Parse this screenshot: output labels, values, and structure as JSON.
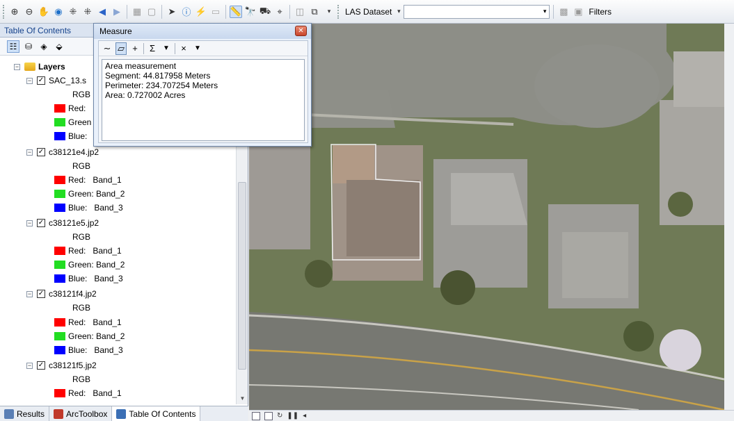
{
  "toolbar": {
    "las_label": "LAS Dataset",
    "filters_label": "Filters"
  },
  "toc": {
    "title": "Table Of Contents",
    "root": "Layers",
    "layers": [
      {
        "name": "SAC_13.s",
        "rgb": "RGB",
        "bands": [
          {
            "label": "Red:",
            "color": "#ff0000"
          },
          {
            "label": "Green",
            "color": "#22dd22"
          },
          {
            "label": "Blue:",
            "color": "#0000ff"
          }
        ]
      },
      {
        "name": "c38121e4.jp2",
        "rgb": "RGB",
        "bands": [
          {
            "label": "Red:   Band_1",
            "color": "#ff0000"
          },
          {
            "label": "Green: Band_2",
            "color": "#22dd22"
          },
          {
            "label": "Blue:   Band_3",
            "color": "#0000ff"
          }
        ]
      },
      {
        "name": "c38121e5.jp2",
        "rgb": "RGB",
        "bands": [
          {
            "label": "Red:   Band_1",
            "color": "#ff0000"
          },
          {
            "label": "Green: Band_2",
            "color": "#22dd22"
          },
          {
            "label": "Blue:   Band_3",
            "color": "#0000ff"
          }
        ]
      },
      {
        "name": "c38121f4.jp2",
        "rgb": "RGB",
        "bands": [
          {
            "label": "Red:   Band_1",
            "color": "#ff0000"
          },
          {
            "label": "Green: Band_2",
            "color": "#22dd22"
          },
          {
            "label": "Blue:   Band_3",
            "color": "#0000ff"
          }
        ]
      },
      {
        "name": "c38121f5.jp2",
        "rgb": "RGB",
        "bands": [
          {
            "label": "Red:   Band_1",
            "color": "#ff0000"
          }
        ]
      }
    ]
  },
  "tabs": [
    {
      "label": "Results",
      "active": false
    },
    {
      "label": "ArcToolbox",
      "active": false
    },
    {
      "label": "Table Of Contents",
      "active": true
    }
  ],
  "measure": {
    "title": "Measure",
    "lines": [
      "Area measurement",
      "Segment: 44.817958 Meters",
      "Perimeter: 234.707254 Meters",
      "Area: 0.727002 Acres"
    ]
  }
}
